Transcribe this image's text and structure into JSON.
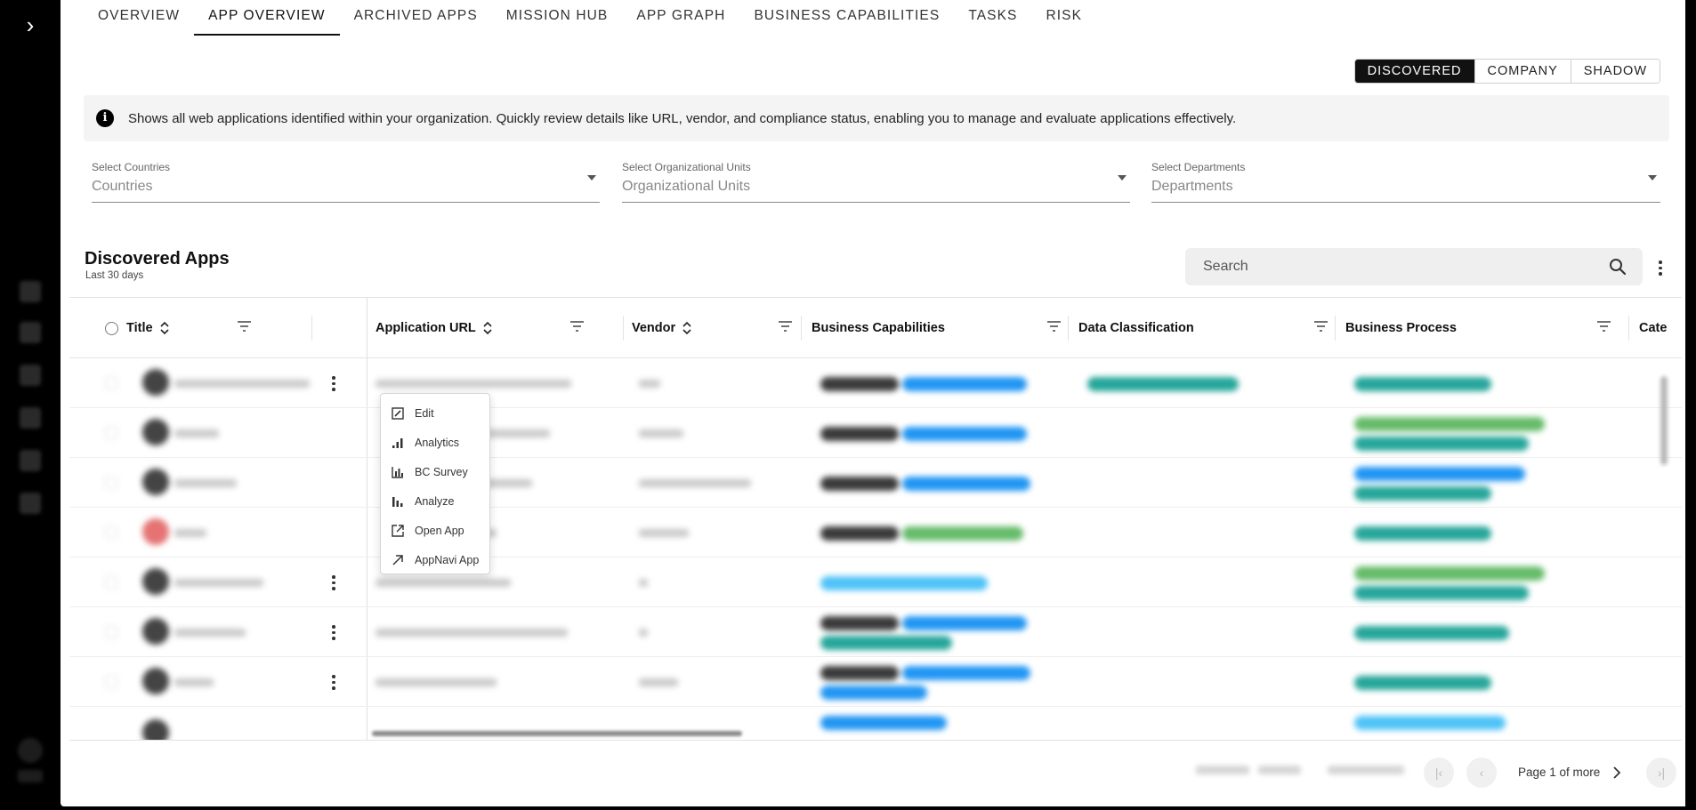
{
  "nav": {
    "tabs": [
      {
        "label": "OVERVIEW"
      },
      {
        "label": "APP OVERVIEW",
        "active": true
      },
      {
        "label": "ARCHIVED APPS"
      },
      {
        "label": "MISSION HUB"
      },
      {
        "label": "APP GRAPH"
      },
      {
        "label": "BUSINESS CAPABILITIES"
      },
      {
        "label": "TASKS"
      },
      {
        "label": "RISK"
      }
    ]
  },
  "view_toggle": {
    "options": [
      "DISCOVERED",
      "COMPANY",
      "SHADOW"
    ],
    "selected": "DISCOVERED"
  },
  "info_banner": {
    "icon": "info-icon",
    "text": "Shows all web applications identified within your organization. Quickly review details like URL, vendor, and compliance status, enabling you to manage and evaluate applications effectively."
  },
  "filters": {
    "countries": {
      "label": "Select Countries",
      "placeholder": "Countries"
    },
    "org_units": {
      "label": "Select Organizational Units",
      "placeholder": "Organizational Units"
    },
    "departments": {
      "label": "Select Departments",
      "placeholder": "Departments"
    }
  },
  "section": {
    "title": "Discovered Apps",
    "subtitle": "Last 30 days",
    "search_placeholder": "Search"
  },
  "table": {
    "columns": [
      "Title",
      "Application URL",
      "Vendor",
      "Business Capabilities",
      "Data Classification",
      "Business Process",
      "Cate"
    ]
  },
  "row_menu": {
    "items": [
      {
        "label": "Edit",
        "icon": "edit-icon"
      },
      {
        "label": "Analytics",
        "icon": "analytics-icon"
      },
      {
        "label": "BC Survey",
        "icon": "bar-chart-icon"
      },
      {
        "label": "Analyze",
        "icon": "analyze-icon"
      },
      {
        "label": "Open App",
        "icon": "open-external-icon"
      },
      {
        "label": "AppNavi App",
        "icon": "arrow-up-right-icon"
      }
    ]
  },
  "pagination": {
    "page_text": "Page 1 of more"
  },
  "colors": {
    "accent": "#111111",
    "tag_dark": "#3a3a3a",
    "tag_blue": "#2196f3",
    "tag_teal": "#26a69a",
    "tag_green": "#66bb6a",
    "tag_cyan": "#4fc3f7"
  }
}
